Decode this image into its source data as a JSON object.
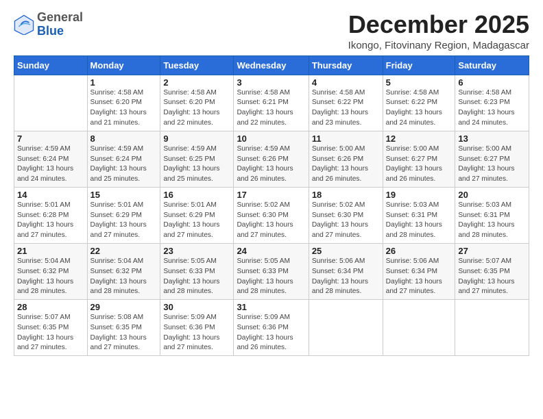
{
  "logo": {
    "general": "General",
    "blue": "Blue"
  },
  "header": {
    "month_year": "December 2025",
    "location": "Ikongo, Fitovinany Region, Madagascar"
  },
  "days_of_week": [
    "Sunday",
    "Monday",
    "Tuesday",
    "Wednesday",
    "Thursday",
    "Friday",
    "Saturday"
  ],
  "weeks": [
    [
      {
        "day": "",
        "info": ""
      },
      {
        "day": "1",
        "info": "Sunrise: 4:58 AM\nSunset: 6:20 PM\nDaylight: 13 hours\nand 21 minutes."
      },
      {
        "day": "2",
        "info": "Sunrise: 4:58 AM\nSunset: 6:20 PM\nDaylight: 13 hours\nand 22 minutes."
      },
      {
        "day": "3",
        "info": "Sunrise: 4:58 AM\nSunset: 6:21 PM\nDaylight: 13 hours\nand 22 minutes."
      },
      {
        "day": "4",
        "info": "Sunrise: 4:58 AM\nSunset: 6:22 PM\nDaylight: 13 hours\nand 23 minutes."
      },
      {
        "day": "5",
        "info": "Sunrise: 4:58 AM\nSunset: 6:22 PM\nDaylight: 13 hours\nand 24 minutes."
      },
      {
        "day": "6",
        "info": "Sunrise: 4:58 AM\nSunset: 6:23 PM\nDaylight: 13 hours\nand 24 minutes."
      }
    ],
    [
      {
        "day": "7",
        "info": "Sunrise: 4:59 AM\nSunset: 6:24 PM\nDaylight: 13 hours\nand 24 minutes."
      },
      {
        "day": "8",
        "info": "Sunrise: 4:59 AM\nSunset: 6:24 PM\nDaylight: 13 hours\nand 25 minutes."
      },
      {
        "day": "9",
        "info": "Sunrise: 4:59 AM\nSunset: 6:25 PM\nDaylight: 13 hours\nand 25 minutes."
      },
      {
        "day": "10",
        "info": "Sunrise: 4:59 AM\nSunset: 6:26 PM\nDaylight: 13 hours\nand 26 minutes."
      },
      {
        "day": "11",
        "info": "Sunrise: 5:00 AM\nSunset: 6:26 PM\nDaylight: 13 hours\nand 26 minutes."
      },
      {
        "day": "12",
        "info": "Sunrise: 5:00 AM\nSunset: 6:27 PM\nDaylight: 13 hours\nand 26 minutes."
      },
      {
        "day": "13",
        "info": "Sunrise: 5:00 AM\nSunset: 6:27 PM\nDaylight: 13 hours\nand 27 minutes."
      }
    ],
    [
      {
        "day": "14",
        "info": "Sunrise: 5:01 AM\nSunset: 6:28 PM\nDaylight: 13 hours\nand 27 minutes."
      },
      {
        "day": "15",
        "info": "Sunrise: 5:01 AM\nSunset: 6:29 PM\nDaylight: 13 hours\nand 27 minutes."
      },
      {
        "day": "16",
        "info": "Sunrise: 5:01 AM\nSunset: 6:29 PM\nDaylight: 13 hours\nand 27 minutes."
      },
      {
        "day": "17",
        "info": "Sunrise: 5:02 AM\nSunset: 6:30 PM\nDaylight: 13 hours\nand 27 minutes."
      },
      {
        "day": "18",
        "info": "Sunrise: 5:02 AM\nSunset: 6:30 PM\nDaylight: 13 hours\nand 27 minutes."
      },
      {
        "day": "19",
        "info": "Sunrise: 5:03 AM\nSunset: 6:31 PM\nDaylight: 13 hours\nand 28 minutes."
      },
      {
        "day": "20",
        "info": "Sunrise: 5:03 AM\nSunset: 6:31 PM\nDaylight: 13 hours\nand 28 minutes."
      }
    ],
    [
      {
        "day": "21",
        "info": "Sunrise: 5:04 AM\nSunset: 6:32 PM\nDaylight: 13 hours\nand 28 minutes."
      },
      {
        "day": "22",
        "info": "Sunrise: 5:04 AM\nSunset: 6:32 PM\nDaylight: 13 hours\nand 28 minutes."
      },
      {
        "day": "23",
        "info": "Sunrise: 5:05 AM\nSunset: 6:33 PM\nDaylight: 13 hours\nand 28 minutes."
      },
      {
        "day": "24",
        "info": "Sunrise: 5:05 AM\nSunset: 6:33 PM\nDaylight: 13 hours\nand 28 minutes."
      },
      {
        "day": "25",
        "info": "Sunrise: 5:06 AM\nSunset: 6:34 PM\nDaylight: 13 hours\nand 28 minutes."
      },
      {
        "day": "26",
        "info": "Sunrise: 5:06 AM\nSunset: 6:34 PM\nDaylight: 13 hours\nand 27 minutes."
      },
      {
        "day": "27",
        "info": "Sunrise: 5:07 AM\nSunset: 6:35 PM\nDaylight: 13 hours\nand 27 minutes."
      }
    ],
    [
      {
        "day": "28",
        "info": "Sunrise: 5:07 AM\nSunset: 6:35 PM\nDaylight: 13 hours\nand 27 minutes."
      },
      {
        "day": "29",
        "info": "Sunrise: 5:08 AM\nSunset: 6:35 PM\nDaylight: 13 hours\nand 27 minutes."
      },
      {
        "day": "30",
        "info": "Sunrise: 5:09 AM\nSunset: 6:36 PM\nDaylight: 13 hours\nand 27 minutes."
      },
      {
        "day": "31",
        "info": "Sunrise: 5:09 AM\nSunset: 6:36 PM\nDaylight: 13 hours\nand 26 minutes."
      },
      {
        "day": "",
        "info": ""
      },
      {
        "day": "",
        "info": ""
      },
      {
        "day": "",
        "info": ""
      }
    ]
  ]
}
